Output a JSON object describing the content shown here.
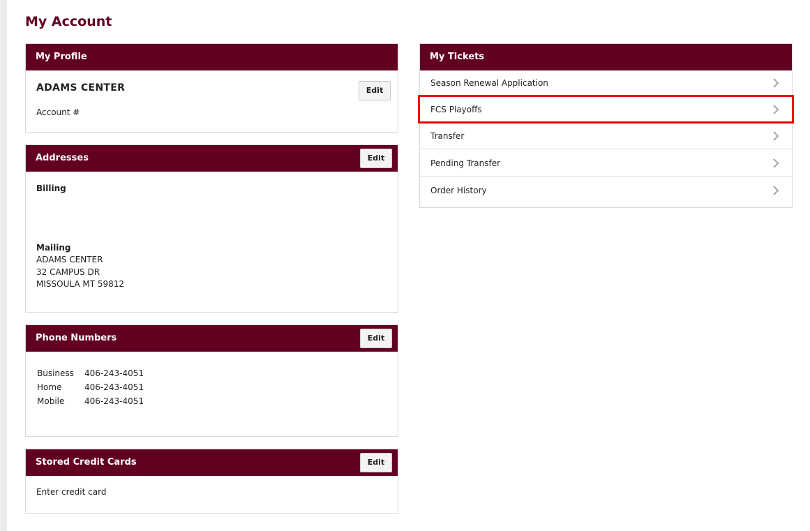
{
  "page": {
    "title": "My Account"
  },
  "profile": {
    "header": "My Profile",
    "name": "ADAMS CENTER",
    "account_label": "Account #",
    "edit_label": "Edit"
  },
  "addresses": {
    "header": "Addresses",
    "edit_label": "Edit",
    "billing_label": "Billing",
    "mailing_label": "Mailing",
    "mailing_lines": [
      "ADAMS CENTER",
      "32 CAMPUS DR",
      "MISSOULA MT 59812"
    ]
  },
  "phones": {
    "header": "Phone Numbers",
    "edit_label": "Edit",
    "rows": [
      {
        "type": "Business",
        "number": "406-243-4051"
      },
      {
        "type": "Home",
        "number": "406-243-4051"
      },
      {
        "type": "Mobile",
        "number": "406-243-4051"
      }
    ]
  },
  "cards": {
    "header": "Stored Credit Cards",
    "edit_label": "Edit",
    "text": "Enter credit card"
  },
  "tickets": {
    "header": "My Tickets",
    "items": [
      {
        "label": "Season Renewal Application"
      },
      {
        "label": "FCS Playoffs"
      },
      {
        "label": "Transfer"
      },
      {
        "label": "Pending Transfer"
      },
      {
        "label": "Order History"
      }
    ]
  },
  "colors": {
    "brand": "#620021",
    "highlight": "#ee0000"
  }
}
